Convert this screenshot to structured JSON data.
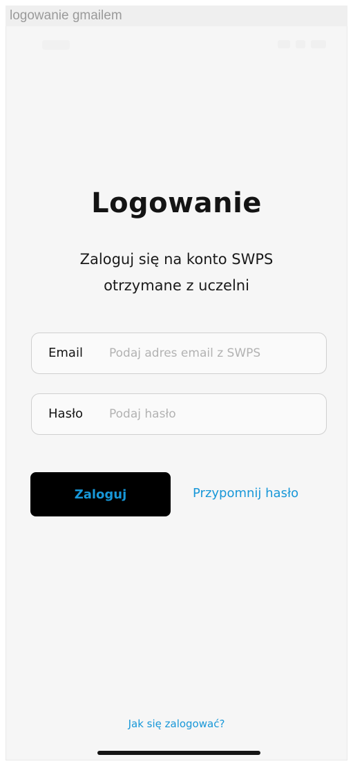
{
  "caption": "logowanie gmailem",
  "screen": {
    "title": "Logowanie",
    "subtitle_line1": "Zaloguj się na konto SWPS",
    "subtitle_line2": "otrzymane z uczelni"
  },
  "form": {
    "email_label": "Email",
    "email_placeholder": "Podaj adres email z SWPS",
    "email_value": "",
    "password_label": "Hasło",
    "password_placeholder": "Podaj hasło",
    "password_value": ""
  },
  "actions": {
    "login_label": "Zaloguj",
    "remind_label": "Przypomnij hasło",
    "help_label": "Jak się zalogować?"
  },
  "colors": {
    "accent": "#1797d8",
    "button_bg": "#000000",
    "screen_bg": "#f6f6f6"
  }
}
